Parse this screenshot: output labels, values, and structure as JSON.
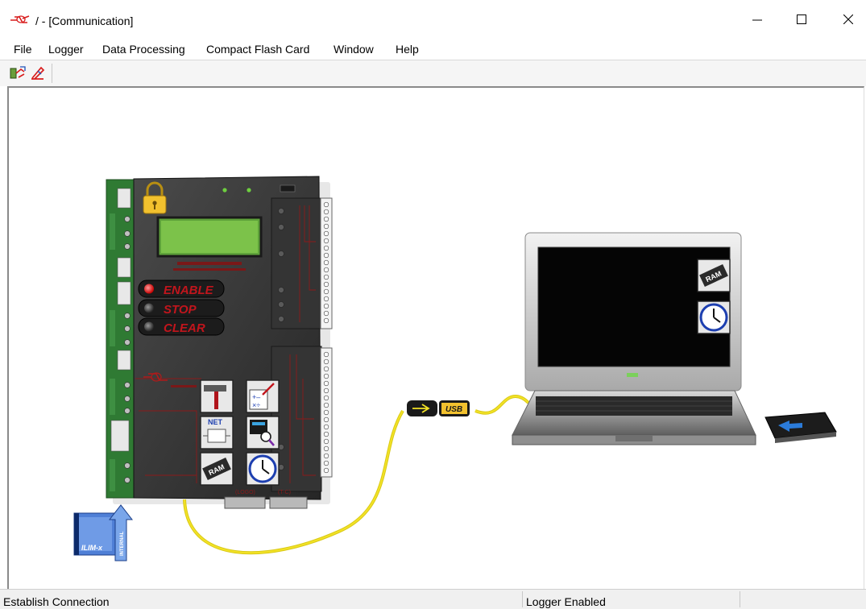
{
  "window": {
    "title": "/ - [Communication]",
    "controls": [
      "minimize",
      "maximize",
      "close"
    ]
  },
  "menu": {
    "items": [
      "File",
      "Logger",
      "Data Processing",
      "Compact Flash Card",
      "Window",
      "Help"
    ]
  },
  "toolbar": {
    "icons": [
      "connect-logger-icon",
      "disconnect-logger-icon"
    ]
  },
  "device": {
    "buttons": [
      "ENABLE",
      "STOP",
      "CLEAR"
    ],
    "function_icons": [
      "hammer-icon",
      "calculator-icon",
      "network-icon",
      "analysis-icon",
      "ram-icon",
      "clock-icon"
    ],
    "port_labels": [
      "(LOGO)",
      "(T-C)"
    ],
    "lock_state": "locked",
    "module_label": "ILIM-x",
    "module_tag": "INTERNAL"
  },
  "cable": {
    "connector_label": "USB",
    "color": "#f2e226"
  },
  "laptop": {
    "screen_icons": [
      "ram-icon",
      "clock-icon"
    ]
  },
  "card": {
    "icon": "compact-flash-icon"
  },
  "status": {
    "left": "Establish Connection",
    "middle": "Logger Enabled",
    "right": ""
  }
}
